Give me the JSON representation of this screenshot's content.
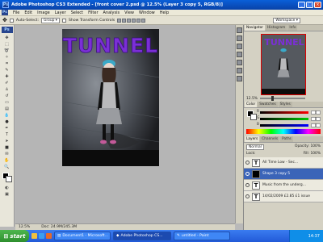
{
  "window": {
    "title": "Adobe Photoshop CS3 Extended - [front cover 2.psd @ 12.5% (Layer 3 copy 5, RGB/8)]",
    "controls": [
      "_",
      "□",
      "×"
    ]
  },
  "menu": {
    "app_badge": "Ps",
    "items": [
      "File",
      "Edit",
      "Image",
      "Layer",
      "Select",
      "Filter",
      "Analysis",
      "View",
      "Window",
      "Help"
    ]
  },
  "options": {
    "auto_select_label": "Auto-Select:",
    "auto_select_value": "Group",
    "transform_label": "Show Transform Controls",
    "workspace_label": "Workspace ▾"
  },
  "tools": {
    "badge": "Ps"
  },
  "document": {
    "headline": "TUNNEL",
    "headline_color": "#7b2fd6"
  },
  "status": {
    "zoom": "12.5%",
    "doc_info": "Doc: 24.9M/245.3M"
  },
  "navigator": {
    "tabs": [
      "Navigator",
      "Histogram",
      "Info"
    ],
    "zoom": "12.5%"
  },
  "color_panel": {
    "tabs": [
      "Color",
      "Swatches",
      "Styles"
    ],
    "channels": [
      {
        "label": "R",
        "value": "0",
        "color": "#e03030"
      },
      {
        "label": "G",
        "value": "0",
        "color": "#30b030"
      },
      {
        "label": "B",
        "value": "0",
        "color": "#3050e0"
      }
    ]
  },
  "layers_panel": {
    "tabs": [
      "Layers",
      "Channels",
      "Paths"
    ],
    "blend_mode": "Normal",
    "opacity_label": "Opacity:",
    "opacity_value": "100%",
    "lock_label": "Lock:",
    "fill_label": "Fill:",
    "fill_value": "100%",
    "layers": [
      {
        "name": "All Time Low - Sec...",
        "type": "text",
        "selected": false
      },
      {
        "name": "Shape 3 copy 5",
        "type": "shape",
        "selected": true
      },
      {
        "name": "Music from the underg...",
        "type": "text",
        "selected": false
      },
      {
        "name": "14/02/2009 £2.85 £1 issue",
        "type": "text",
        "selected": false
      }
    ]
  },
  "taskbar": {
    "start_label": "start",
    "tasks": [
      {
        "label": "Document1 - Microsoft...",
        "active": false
      },
      {
        "label": "Adobe Photoshop CS...",
        "active": true
      },
      {
        "label": "untitled - Paint",
        "active": false
      }
    ],
    "clock": "14:37"
  }
}
